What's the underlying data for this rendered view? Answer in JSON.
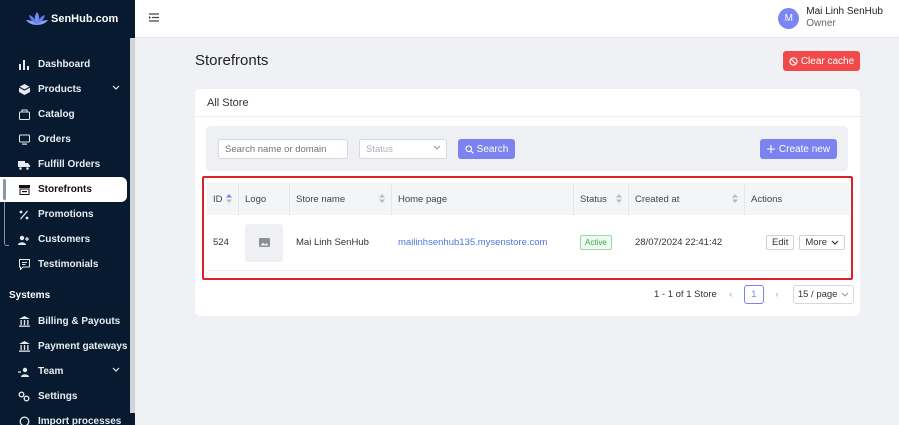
{
  "app": {
    "name": "SenHub.com"
  },
  "sidebar": {
    "items": [
      {
        "label": "Dashboard",
        "icon": "bar-chart-icon"
      },
      {
        "label": "Products",
        "icon": "box-icon",
        "expandable": true
      },
      {
        "label": "Catalog",
        "icon": "catalog-icon"
      },
      {
        "label": "Orders",
        "icon": "monitor-icon"
      },
      {
        "label": "Fulfill Orders",
        "icon": "truck-icon"
      },
      {
        "label": "Storefronts",
        "icon": "store-icon",
        "active": true
      },
      {
        "label": "Promotions",
        "icon": "percent-icon"
      },
      {
        "label": "Customers",
        "icon": "users-icon"
      },
      {
        "label": "Testimonials",
        "icon": "message-icon"
      }
    ],
    "section_title": "Systems",
    "system_items": [
      {
        "label": "Billing & Payouts",
        "icon": "bank-icon"
      },
      {
        "label": "Payment gateways",
        "icon": "bank-icon"
      },
      {
        "label": "Team",
        "icon": "team-icon",
        "expandable": true
      },
      {
        "label": "Settings",
        "icon": "gears-icon"
      },
      {
        "label": "Import processes",
        "icon": "sync-icon"
      }
    ]
  },
  "header": {
    "user_initial": "M",
    "user_name": "Mai Linh SenHub",
    "user_role": "Owner"
  },
  "page": {
    "title": "Storefronts",
    "clear_cache_label": "Clear cache",
    "card_title": "All Store"
  },
  "filters": {
    "search_placeholder": "Search name or domain",
    "status_placeholder": "Status",
    "search_label": "Search",
    "create_label": "Create new"
  },
  "table": {
    "columns": [
      "ID",
      "Logo",
      "Store name",
      "Home page",
      "Status",
      "Created at",
      "Actions"
    ],
    "rows": [
      {
        "id": "524",
        "store_name": "Mai Linh SenHub",
        "home_page": "mailinhsenhub135.mysenstore.com",
        "status": "Active",
        "created_at": "28/07/2024 22:41:42",
        "edit_label": "Edit",
        "more_label": "More"
      }
    ]
  },
  "pagination": {
    "summary": "1 - 1 of 1 Store",
    "current_page": "1",
    "page_size": "15 / page"
  },
  "colors": {
    "sidebar_bg": "#071a2f",
    "accent": "#7c83f0",
    "danger": "#f04a4a",
    "success": "#3aa454",
    "link": "#4a78e4"
  }
}
